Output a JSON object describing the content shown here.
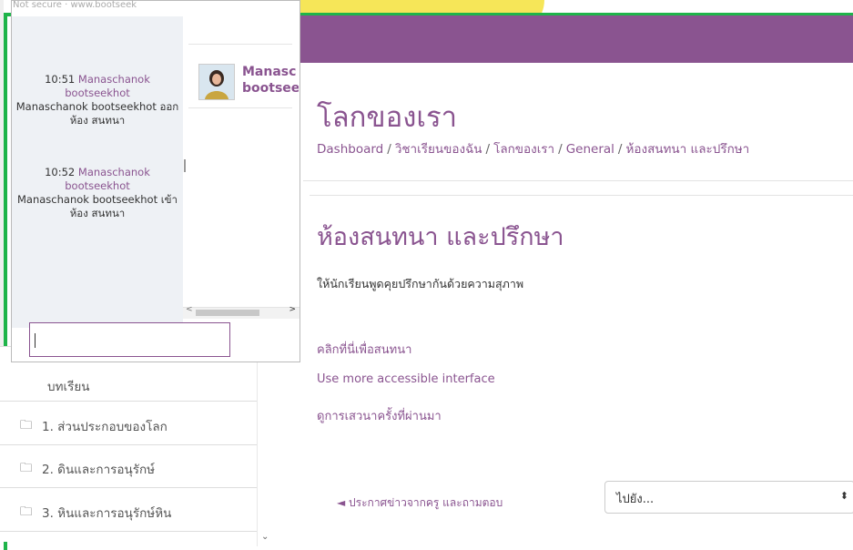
{
  "colors": {
    "brand": "#8a5490",
    "frame": "#1fb44a",
    "chat_bg": "#eef1f5"
  },
  "chat_window": {
    "address": "Not secure · www.bootseek",
    "messages": [
      {
        "time": "10:51",
        "user": "Manaschanok bootseekhot",
        "text": "Manaschanok bootseekhot ออกห้อง สนทนา"
      },
      {
        "time": "10:52",
        "user": "Manaschanok bootseekhot",
        "text": "Manaschanok bootseekhot เข้าห้อง สนทนา"
      }
    ],
    "user_line1": "Manasc",
    "user_line2": "bootsee",
    "input_value": ""
  },
  "page": {
    "course_title": "โลกของเรา",
    "breadcrumb": [
      "Dashboard",
      "วิชาเรียนของฉัน",
      "โลกของเรา",
      "General",
      "ห้องสนทนา และปรึกษา"
    ],
    "activity_title": "ห้องสนทนา และปรึกษา",
    "intro": "ให้นักเรียนพูดคุยปรึกษากันด้วยความสุภาพ",
    "links": {
      "enter_chat": "คลิกที่นี่เพื่อสนทนา",
      "accessible": "Use more accessible interface",
      "past_sessions": "ดูการเสวนาครั้งที่ผ่านมา"
    },
    "prev_activity": "◄ ประกาศข่าวจากครู และถามตอบ",
    "jump_to": "ไปยัง..."
  },
  "left_nav": {
    "partial_item": "บทเรียน",
    "items": [
      "1. ส่วนประกอบของโลก",
      "2. ดินและการอนุรักษ์",
      "3. หินและการอนุรักษ์หิน"
    ]
  }
}
